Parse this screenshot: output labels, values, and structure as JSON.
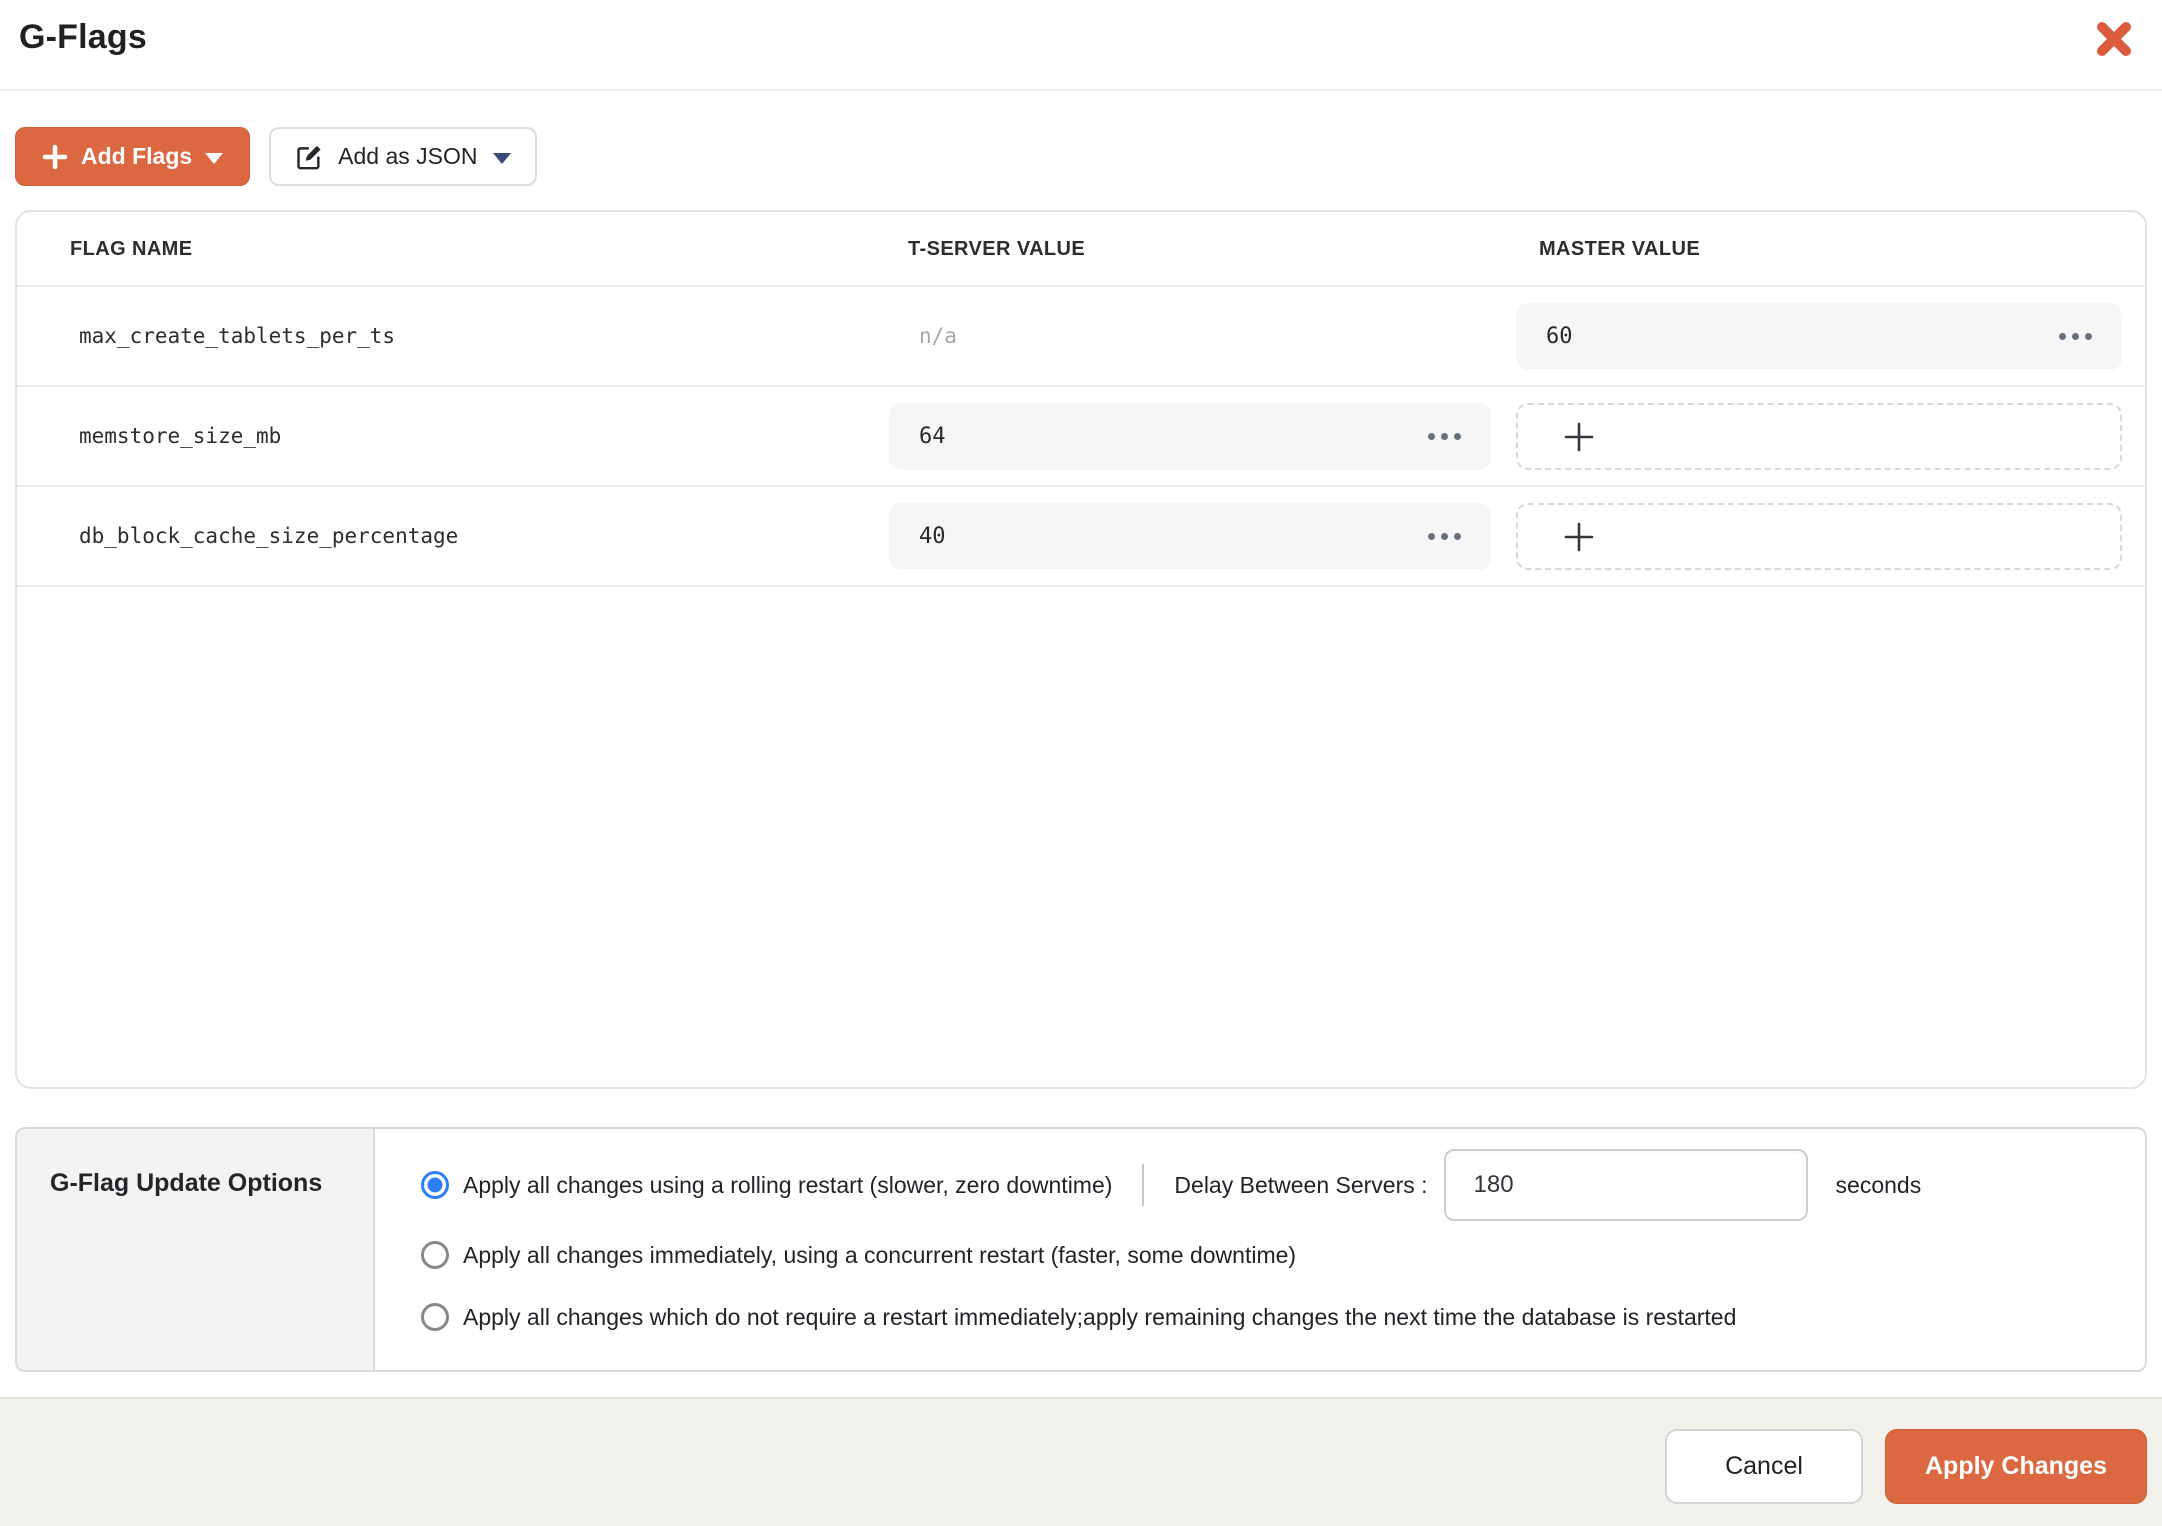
{
  "colors": {
    "accent": "#DB6841",
    "radio_selected": "#2D7FF8",
    "value_box_bg": "#F6F6F7",
    "footer_bg": "#F1F0EA"
  },
  "header": {
    "title": "G-Flags"
  },
  "toolbar": {
    "add_flags_label": "Add Flags",
    "add_json_label": "Add as JSON",
    "icons": [
      "plus-icon",
      "caret-down-icon",
      "edit-icon"
    ]
  },
  "table": {
    "columns": [
      "FLAG NAME",
      "T-SERVER VALUE",
      "MASTER VALUE"
    ],
    "rows": [
      {
        "flag_name": "max_create_tablets_per_ts",
        "tserver_value": "n/a",
        "master_value": "60"
      },
      {
        "flag_name": "memstore_size_mb",
        "tserver_value": "64",
        "master_value": ""
      },
      {
        "flag_name": "db_block_cache_size_percentage",
        "tserver_value": "40",
        "master_value": ""
      }
    ]
  },
  "options": {
    "title": "G-Flag Update Options",
    "radios": [
      {
        "label": "Apply all changes using a rolling restart (slower, zero downtime)",
        "selected": true
      },
      {
        "label": "Apply all changes immediately, using a concurrent restart (faster, some downtime)",
        "selected": false
      },
      {
        "label": "Apply all changes which do not require a restart immediately;apply remaining changes the next time the database is restarted",
        "selected": false
      }
    ],
    "delay": {
      "label": "Delay Between Servers :",
      "value": "180",
      "unit": "seconds"
    }
  },
  "footer": {
    "cancel_label": "Cancel",
    "apply_label": "Apply Changes"
  }
}
